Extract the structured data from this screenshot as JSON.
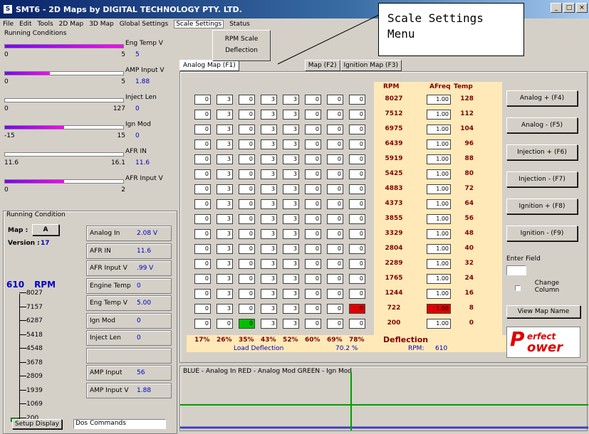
{
  "window": {
    "title": "SMT6 - 2D Maps  by  DIGITAL TECHNOLOGY PTY. LTD.",
    "app_icon": "S",
    "controls": [
      "_",
      "□",
      "×"
    ]
  },
  "menu": [
    "File",
    "Edit",
    "Tools",
    "2D Map",
    "3D Map",
    "Global Settings",
    "Scale Settings",
    "Status"
  ],
  "dropdown": {
    "items": [
      "RPM Scale",
      "Deflection"
    ]
  },
  "callout": {
    "text": "Scale Settings Menu"
  },
  "running": {
    "title": "Running Conditions",
    "gauges": [
      {
        "name": "Eng Temp V",
        "min": "0",
        "max": "5",
        "value": "5",
        "fill": 1.0
      },
      {
        "name": "AMP Input V",
        "min": "0",
        "max": "5",
        "value": "1.88",
        "fill": 0.38
      },
      {
        "name": "Inject Len",
        "min": "0",
        "max": "127",
        "value": "0",
        "fill": 0
      },
      {
        "name": "Ign Mod",
        "min": "-15",
        "max": "15",
        "value": "0",
        "fill": 0.5
      },
      {
        "name": "AFR IN",
        "min": "11.6",
        "max": "16.1",
        "value": "11.6",
        "fill": 0
      },
      {
        "name": "AFR Input V",
        "min": "0",
        "max": "2",
        "value": "",
        "fill": 0.5
      }
    ]
  },
  "condition": {
    "title": "Running Condition",
    "map_label": "Map :",
    "map_value": "A",
    "version_label": "Version :",
    "version_value": "17",
    "rpm_value": "610",
    "rpm_label": "RPM",
    "ticks": [
      "8027",
      "7157",
      "6287",
      "5418",
      "4548",
      "3678",
      "2809",
      "1939",
      "1069",
      "200"
    ],
    "readouts": [
      {
        "label": "Analog In",
        "value": "2.08 V"
      },
      {
        "label": "AFR IN",
        "value": "11.6"
      },
      {
        "label": "AFR Input V",
        "value": ".99 V"
      },
      {
        "label": "Engine Temp",
        "value": "0"
      },
      {
        "label": "Eng Temp V",
        "value": "5.00"
      },
      {
        "label": "Ign Mod",
        "value": "0"
      },
      {
        "label": "Inject Len",
        "value": "0"
      },
      {
        "label": "",
        "value": ""
      },
      {
        "label": "AMP Input",
        "value": "56"
      },
      {
        "label": "AMP Input V",
        "value": "1.88"
      }
    ],
    "setup_button": "Setup Display",
    "dos_field": "Dos Commands"
  },
  "tabs": [
    "Analog Map (F1)",
    "Map (F2)",
    "Ignition Map (F3)"
  ],
  "grid": {
    "rpm_header": "RPM",
    "afr_header": "AFreq",
    "temp_header": "Temp",
    "rpm": [
      "8027",
      "7512",
      "6975",
      "6439",
      "5919",
      "5425",
      "4883",
      "4373",
      "3855",
      "3329",
      "2804",
      "2289",
      "1765",
      "1244",
      "722",
      "200"
    ],
    "afr": [
      "1.00",
      "1.00",
      "1.00",
      "1.00",
      "1.00",
      "1.00",
      "1.00",
      "1.00",
      "1.00",
      "1.00",
      "1.00",
      "1.00",
      "1.00",
      "1.00",
      "1.00",
      "1.00"
    ],
    "temp": [
      "128",
      "112",
      "104",
      "96",
      "88",
      "80",
      "72",
      "64",
      "56",
      "48",
      "40",
      "32",
      "24",
      "16",
      "8",
      "0"
    ],
    "rows": [
      [
        "0",
        "3",
        "0",
        "3",
        "3",
        "0",
        "0",
        "0"
      ],
      [
        "0",
        "3",
        "0",
        "3",
        "3",
        "0",
        "0",
        "0"
      ],
      [
        "0",
        "3",
        "0",
        "3",
        "3",
        "0",
        "0",
        "0"
      ],
      [
        "0",
        "3",
        "0",
        "3",
        "3",
        "0",
        "0",
        "0"
      ],
      [
        "0",
        "3",
        "0",
        "3",
        "3",
        "0",
        "0",
        "0"
      ],
      [
        "0",
        "3",
        "0",
        "3",
        "3",
        "0",
        "0",
        "0"
      ],
      [
        "0",
        "3",
        "0",
        "3",
        "3",
        "0",
        "0",
        "0"
      ],
      [
        "0",
        "3",
        "0",
        "3",
        "3",
        "0",
        "0",
        "0"
      ],
      [
        "0",
        "3",
        "0",
        "3",
        "3",
        "0",
        "0",
        "0"
      ],
      [
        "0",
        "3",
        "0",
        "3",
        "3",
        "0",
        "0",
        "0"
      ],
      [
        "0",
        "3",
        "0",
        "3",
        "3",
        "0",
        "0",
        "0"
      ],
      [
        "0",
        "3",
        "0",
        "3",
        "3",
        "0",
        "0",
        "0"
      ],
      [
        "0",
        "3",
        "0",
        "3",
        "3",
        "0",
        "0",
        "0"
      ],
      [
        "0",
        "3",
        "0",
        "3",
        "3",
        "0",
        "0",
        "0"
      ],
      [
        "0",
        "3",
        "0",
        "3",
        "3",
        "0",
        "0",
        "0"
      ],
      [
        "0",
        "0",
        "0",
        "3",
        "3",
        "0",
        "0",
        "0"
      ]
    ],
    "deflection": [
      "17%",
      "26%",
      "35%",
      "43%",
      "52%",
      "60%",
      "69%",
      "78%"
    ],
    "deflection_title": "Deflection",
    "load_label": "Load Deflection",
    "load_value": "70.2 %",
    "rpm_label": "RPM:",
    "rpm_value": "610"
  },
  "buttons": [
    "Analog + (F4)",
    "Analog - (F5)",
    "Injection + (F6)",
    "Injection - (F7)",
    "Ignition + (F8)",
    "Ignition - (F9)"
  ],
  "enter_field": "Enter Field",
  "change_column": "Change Column",
  "view_map_name": "View Map Name",
  "logo": {
    "line1": "erfect",
    "line2": "ower",
    "big1": "P",
    "big2": "P"
  },
  "legend": "BLUE - Analog In     RED - Analog Mod     GREEN - Ign Mod",
  "colors": {
    "green_cell": "#00c000",
    "red_cell": "#e00000",
    "header_bg": "#ffe9b8"
  }
}
